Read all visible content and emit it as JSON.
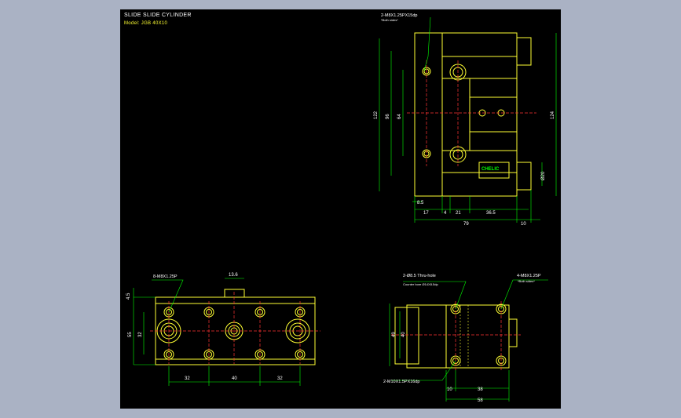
{
  "title_block": {
    "title": "SLIDE SLIDE CYLINDER",
    "model": "Model: JGB 40X10"
  },
  "top_view": {
    "dims": [
      "122",
      "96",
      "64",
      "124",
      "8.5",
      "17",
      "4",
      "21",
      "36.5",
      "79",
      "10",
      "Ø20"
    ],
    "callout": "2-M8X1.25PX15dp",
    "callout_sub": "*Both sides*",
    "logo": "CHELIC"
  },
  "bottom_left_view": {
    "dims": [
      "13.6",
      "4.5",
      "55",
      "32",
      "32",
      "40",
      "32"
    ],
    "callout": "8-M8X1.25P"
  },
  "bottom_right_view": {
    "dims": [
      "49",
      "40",
      "10",
      "38",
      "58"
    ],
    "callout_a": "2-Ø8.5 Thru-hole",
    "callout_a2": "Counter bore Ø14X8.5dp",
    "callout_b": "4-M8X1.25P",
    "callout_b_sub": "*Both sides*",
    "callout_c": "2-M10X1.5PX16dp"
  },
  "colors": {
    "canvas": "#000000",
    "outline": "#ffff33",
    "dimension": "#00ff00",
    "centerline": "#ff3333",
    "text": "#ffffff"
  }
}
